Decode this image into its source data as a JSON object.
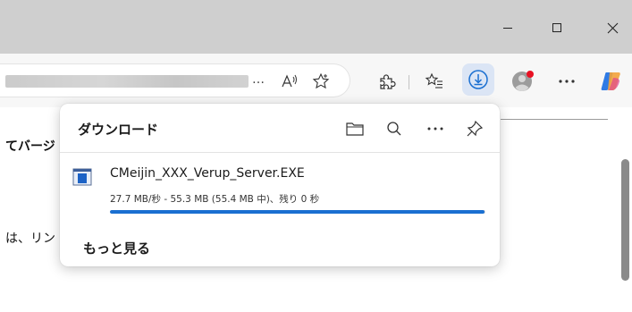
{
  "window": {
    "minimize_label": "—",
    "maximize_label": "☐",
    "close_label": "✕"
  },
  "toolbar": {
    "url_suffix": "…",
    "active_icon_color": "#1a6fd1"
  },
  "page": {
    "heading_fragment": "てバージ",
    "body_fragment": "は、リン"
  },
  "download_panel": {
    "title": "ダウンロード",
    "file": {
      "name": "CMeijin_XXX_Verup_Server.EXE",
      "status": "27.7 MB/秒 - 55.3 MB (55.4 MB 中)、残り 0 秒",
      "progress_percent": 99.8
    },
    "more_label": "もっと見る"
  },
  "colors": {
    "titlebar_bg": "#cfcfcf",
    "toolbar_bg": "#f7f7f7",
    "progress": "#1a6fd1",
    "notification_dot": "#e81123"
  }
}
